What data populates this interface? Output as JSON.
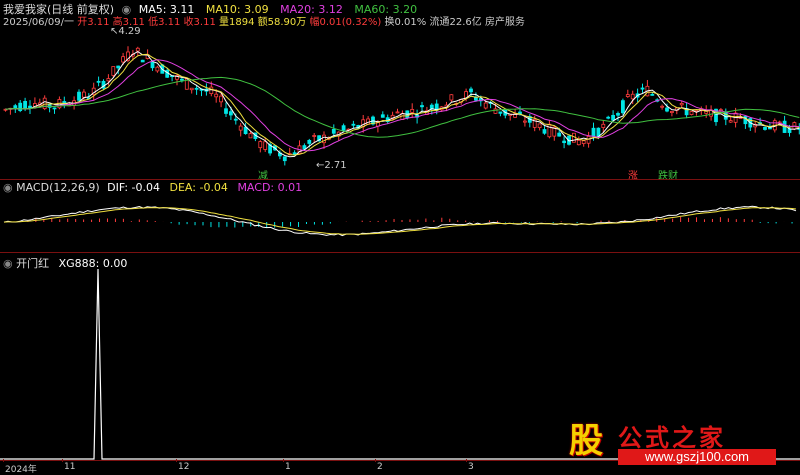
{
  "main_panel": {
    "title": "我爱我家(日线 前复权)",
    "ma5": "MA5: 3.11",
    "ma10": "MA10: 3.09",
    "ma20": "MA20: 3.12",
    "ma60": "MA60: 3.20",
    "date": "2025/06/09/一",
    "open": "开3.11",
    "high": "高3.11",
    "low": "低3.11",
    "close": "收3.11",
    "volume": "量1894",
    "amount": "额58.90万",
    "change": "幅0.01(0.32%)",
    "turnover": "换0.01%",
    "float_cap": "流通22.6亿",
    "sector": "房产服务",
    "high_marker": "4.29",
    "low_marker": "2.71",
    "signal_reduce": "减",
    "signal_rise": "涨",
    "signal_limit": "跌财"
  },
  "macd_panel": {
    "title": "MACD(12,26,9)",
    "dif": "DIF: -0.04",
    "dea": "DEA: -0.04",
    "macd": "MACD: 0.01"
  },
  "custom_panel": {
    "title": "开门红",
    "value": "XG888: 0.00"
  },
  "time_axis": [
    "2024年",
    "11",
    "12",
    "1",
    "2",
    "3"
  ],
  "colors": {
    "up": "#ff3c3c",
    "down": "#00e5e5",
    "ma5": "#ffffff",
    "ma10": "#f0e040",
    "ma20": "#e040e0",
    "ma60": "#40c040",
    "panel_border": "#7a1010"
  },
  "watermark": {
    "logo": "股",
    "title": "公式之家",
    "url": "www.gszj100.com"
  }
}
